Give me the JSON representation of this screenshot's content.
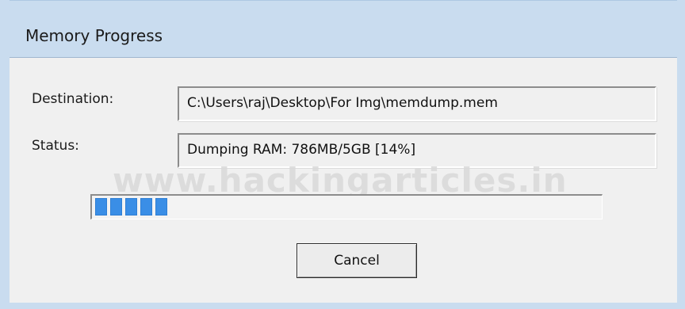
{
  "window": {
    "title": "Memory Progress"
  },
  "form": {
    "destination_label": "Destination:",
    "destination_value": "C:\\Users\\raj\\Desktop\\For Img\\memdump.mem",
    "status_label": "Status:",
    "status_value": "Dumping RAM: 786MB/5GB [14%]"
  },
  "progress": {
    "fraction": 0.14,
    "color": "#3a8ee6"
  },
  "watermark": "www.hackingarticles.in",
  "buttons": {
    "cancel_label": "Cancel"
  },
  "colors": {
    "frame": "#c9dcef",
    "client": "#f0f0f0"
  }
}
